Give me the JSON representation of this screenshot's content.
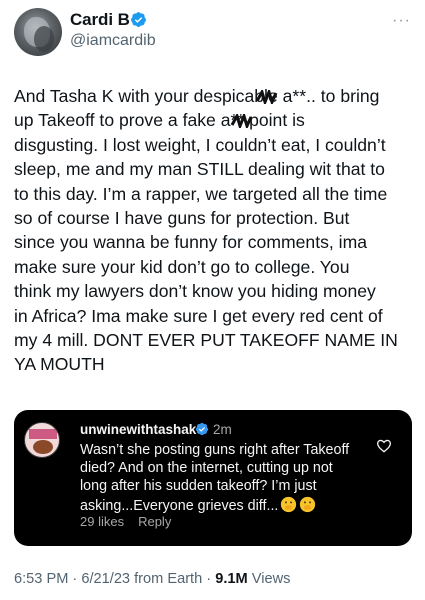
{
  "tweet": {
    "display_name": "Cardi B",
    "handle": "@iamcardib",
    "verified_color": "#1d9bf0",
    "text": "And Tasha K with your despicable a**.. to bring\nup Takeoff to prove a fake a** point is\ndisgusting. I lost weight, I couldn’t eat, I couldn’t\nsleep, me and my man STILL dealing wit that to\nto this day. I’m a rapper, we targeted all the time\nso of course I have guns for protection. But\nsince you wanna be funny for comments, ima\nmake sure your kid don’t go to college. You\nthink my lawyers don’t know you hiding money\nin Africa? Ima make sure I get every red cent of\nmy 4 mill. DONT EVER PUT TAKEOFF NAME IN\nYA MOUTH",
    "more_icon": "ellipsis-icon"
  },
  "quoted_comment": {
    "username": "unwinewithtashak",
    "time": "2m",
    "text": "Wasn’t she posting guns right after Takeoff\ndied? And on the internet, cutting up not\nlong after his sudden takeoff? I’m just\nasking...Everyone grieves diff...",
    "emojis": [
      "face-with-hand-over-mouth-emoji",
      "face-with-hand-over-mouth-emoji"
    ],
    "likes": "29 likes",
    "reply": "Reply",
    "heart_icon": "heart-outline-icon"
  },
  "footer": {
    "time": "6:53 PM",
    "separator": "·",
    "date": "6/21/23 from Earth",
    "views_count": "9.1M",
    "views_label": "Views"
  }
}
